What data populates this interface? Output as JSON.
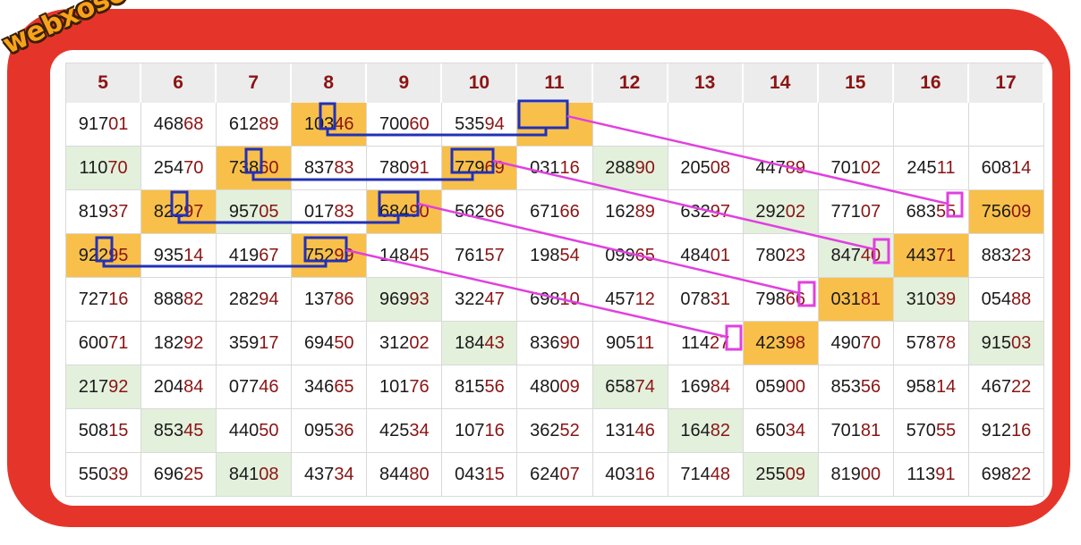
{
  "watermark": "webxoso.net",
  "colors": {
    "frame": "#e5352b",
    "highlight_orange": "#f8c04a",
    "highlight_green": "#e3f0dc",
    "digit_dark_red": "#8b1414",
    "box_blue": "#2230b8",
    "line_magenta": "#e040e0"
  },
  "headers": [
    "5",
    "6",
    "7",
    "8",
    "9",
    "10",
    "11",
    "12",
    "13",
    "14",
    "15",
    "16",
    "17"
  ],
  "rows": [
    [
      {
        "v": "91701",
        "bg": ""
      },
      {
        "v": "46868",
        "bg": ""
      },
      {
        "v": "61289",
        "bg": ""
      },
      {
        "v": "10346",
        "bg": "o"
      },
      {
        "v": "70060",
        "bg": ""
      },
      {
        "v": "53594",
        "bg": ""
      },
      {
        "v": "",
        "bg": "o"
      },
      {
        "v": "",
        "bg": ""
      },
      {
        "v": "",
        "bg": ""
      },
      {
        "v": "",
        "bg": ""
      },
      {
        "v": "",
        "bg": ""
      },
      {
        "v": "",
        "bg": ""
      },
      {
        "v": "",
        "bg": ""
      }
    ],
    [
      {
        "v": "11070",
        "bg": "g"
      },
      {
        "v": "25470",
        "bg": ""
      },
      {
        "v": "73860",
        "bg": "o"
      },
      {
        "v": "83783",
        "bg": ""
      },
      {
        "v": "78091",
        "bg": ""
      },
      {
        "v": "77969",
        "bg": "o"
      },
      {
        "v": "03116",
        "bg": ""
      },
      {
        "v": "28890",
        "bg": "g"
      },
      {
        "v": "20508",
        "bg": ""
      },
      {
        "v": "44789",
        "bg": ""
      },
      {
        "v": "70102",
        "bg": ""
      },
      {
        "v": "24511",
        "bg": ""
      },
      {
        "v": "60814",
        "bg": ""
      }
    ],
    [
      {
        "v": "81937",
        "bg": ""
      },
      {
        "v": "82297",
        "bg": "o"
      },
      {
        "v": "95705",
        "bg": "g"
      },
      {
        "v": "01783",
        "bg": ""
      },
      {
        "v": "68490",
        "bg": "o"
      },
      {
        "v": "56266",
        "bg": ""
      },
      {
        "v": "67166",
        "bg": ""
      },
      {
        "v": "16289",
        "bg": ""
      },
      {
        "v": "63297",
        "bg": ""
      },
      {
        "v": "29202",
        "bg": "g"
      },
      {
        "v": "77107",
        "bg": ""
      },
      {
        "v": "68355",
        "bg": ""
      },
      {
        "v": "75609",
        "bg": "o"
      }
    ],
    [
      {
        "v": "92295",
        "bg": "o"
      },
      {
        "v": "93514",
        "bg": ""
      },
      {
        "v": "41967",
        "bg": ""
      },
      {
        "v": "75299",
        "bg": "o"
      },
      {
        "v": "14845",
        "bg": ""
      },
      {
        "v": "76157",
        "bg": ""
      },
      {
        "v": "19854",
        "bg": ""
      },
      {
        "v": "09965",
        "bg": ""
      },
      {
        "v": "48401",
        "bg": ""
      },
      {
        "v": "78023",
        "bg": ""
      },
      {
        "v": "84740",
        "bg": "g"
      },
      {
        "v": "44371",
        "bg": "o"
      },
      {
        "v": "88323",
        "bg": ""
      }
    ],
    [
      {
        "v": "72716",
        "bg": ""
      },
      {
        "v": "88882",
        "bg": ""
      },
      {
        "v": "28294",
        "bg": ""
      },
      {
        "v": "13786",
        "bg": ""
      },
      {
        "v": "96993",
        "bg": "g"
      },
      {
        "v": "32247",
        "bg": ""
      },
      {
        "v": "69810",
        "bg": ""
      },
      {
        "v": "45712",
        "bg": ""
      },
      {
        "v": "07831",
        "bg": ""
      },
      {
        "v": "79866",
        "bg": ""
      },
      {
        "v": "03181",
        "bg": "o"
      },
      {
        "v": "31039",
        "bg": "g"
      },
      {
        "v": "05488",
        "bg": ""
      }
    ],
    [
      {
        "v": "60071",
        "bg": ""
      },
      {
        "v": "18292",
        "bg": ""
      },
      {
        "v": "35917",
        "bg": ""
      },
      {
        "v": "69450",
        "bg": ""
      },
      {
        "v": "31202",
        "bg": ""
      },
      {
        "v": "18443",
        "bg": "g"
      },
      {
        "v": "83690",
        "bg": ""
      },
      {
        "v": "90511",
        "bg": ""
      },
      {
        "v": "11427",
        "bg": ""
      },
      {
        "v": "42398",
        "bg": "o"
      },
      {
        "v": "49070",
        "bg": ""
      },
      {
        "v": "57878",
        "bg": ""
      },
      {
        "v": "91503",
        "bg": "g"
      }
    ],
    [
      {
        "v": "21792",
        "bg": "g"
      },
      {
        "v": "20484",
        "bg": ""
      },
      {
        "v": "07746",
        "bg": ""
      },
      {
        "v": "34665",
        "bg": ""
      },
      {
        "v": "10176",
        "bg": ""
      },
      {
        "v": "81556",
        "bg": ""
      },
      {
        "v": "48009",
        "bg": ""
      },
      {
        "v": "65874",
        "bg": "g"
      },
      {
        "v": "16984",
        "bg": ""
      },
      {
        "v": "05900",
        "bg": ""
      },
      {
        "v": "85356",
        "bg": ""
      },
      {
        "v": "95814",
        "bg": ""
      },
      {
        "v": "46722",
        "bg": ""
      }
    ],
    [
      {
        "v": "50815",
        "bg": ""
      },
      {
        "v": "85345",
        "bg": "g"
      },
      {
        "v": "44050",
        "bg": ""
      },
      {
        "v": "09536",
        "bg": ""
      },
      {
        "v": "42534",
        "bg": ""
      },
      {
        "v": "10716",
        "bg": ""
      },
      {
        "v": "36252",
        "bg": ""
      },
      {
        "v": "13146",
        "bg": ""
      },
      {
        "v": "16482",
        "bg": "g"
      },
      {
        "v": "65034",
        "bg": ""
      },
      {
        "v": "70181",
        "bg": ""
      },
      {
        "v": "57055",
        "bg": ""
      },
      {
        "v": "91216",
        "bg": ""
      }
    ],
    [
      {
        "v": "55039",
        "bg": ""
      },
      {
        "v": "69625",
        "bg": ""
      },
      {
        "v": "84108",
        "bg": "g"
      },
      {
        "v": "43734",
        "bg": ""
      },
      {
        "v": "84480",
        "bg": ""
      },
      {
        "v": "04315",
        "bg": ""
      },
      {
        "v": "62407",
        "bg": ""
      },
      {
        "v": "40316",
        "bg": ""
      },
      {
        "v": "71448",
        "bg": ""
      },
      {
        "v": "25509",
        "bg": "g"
      },
      {
        "v": "81900",
        "bg": ""
      },
      {
        "v": "11391",
        "bg": ""
      },
      {
        "v": "69822",
        "bg": ""
      }
    ]
  ]
}
